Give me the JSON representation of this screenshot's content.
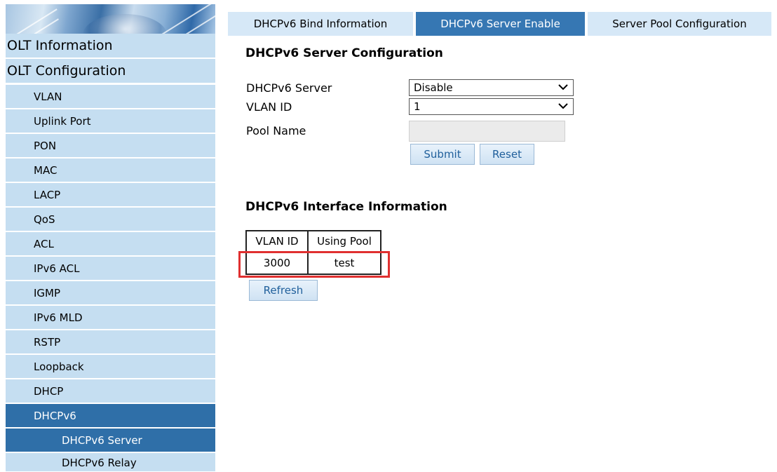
{
  "sidebar": {
    "items": [
      {
        "label": "OLT Information"
      },
      {
        "label": "OLT Configuration"
      },
      {
        "label": "VLAN"
      },
      {
        "label": "Uplink Port"
      },
      {
        "label": "PON"
      },
      {
        "label": "MAC"
      },
      {
        "label": "LACP"
      },
      {
        "label": "QoS"
      },
      {
        "label": "ACL"
      },
      {
        "label": "IPv6 ACL"
      },
      {
        "label": "IGMP"
      },
      {
        "label": "IPv6 MLD"
      },
      {
        "label": "RSTP"
      },
      {
        "label": "Loopback"
      },
      {
        "label": "DHCP"
      },
      {
        "label": "DHCPv6"
      },
      {
        "label": "DHCPv6 Server"
      },
      {
        "label": "DHCPv6 Relay"
      }
    ],
    "active_items": [
      "DHCPv6",
      "DHCPv6 Server"
    ]
  },
  "tabs": [
    {
      "label": "DHCPv6 Bind Information"
    },
    {
      "label": "DHCPv6 Server Enable"
    },
    {
      "label": "Server Pool Configuration"
    }
  ],
  "active_tab": "DHCPv6 Server Enable",
  "server_config": {
    "title": "DHCPv6 Server Configuration",
    "server_label": "DHCPv6 Server",
    "server_value": "Disable",
    "vlan_label": "VLAN ID",
    "vlan_value": "1",
    "pool_label": "Pool Name",
    "pool_value": "",
    "submit_label": "Submit",
    "reset_label": "Reset"
  },
  "interface_info": {
    "title": "DHCPv6 Interface Information",
    "headers": [
      "VLAN ID",
      "Using Pool"
    ],
    "rows": [
      [
        "3000",
        "test"
      ]
    ],
    "refresh_label": "Refresh"
  },
  "colors": {
    "nav_bg": "#c5def1",
    "nav_active_bg": "#2f6fa8",
    "tab_bg": "#d6e8f7",
    "tab_active_bg": "#3677b3",
    "highlight": "#e03030"
  },
  "icons": {
    "dropdown": "chevron-down-icon",
    "logo": "banner-logo"
  }
}
